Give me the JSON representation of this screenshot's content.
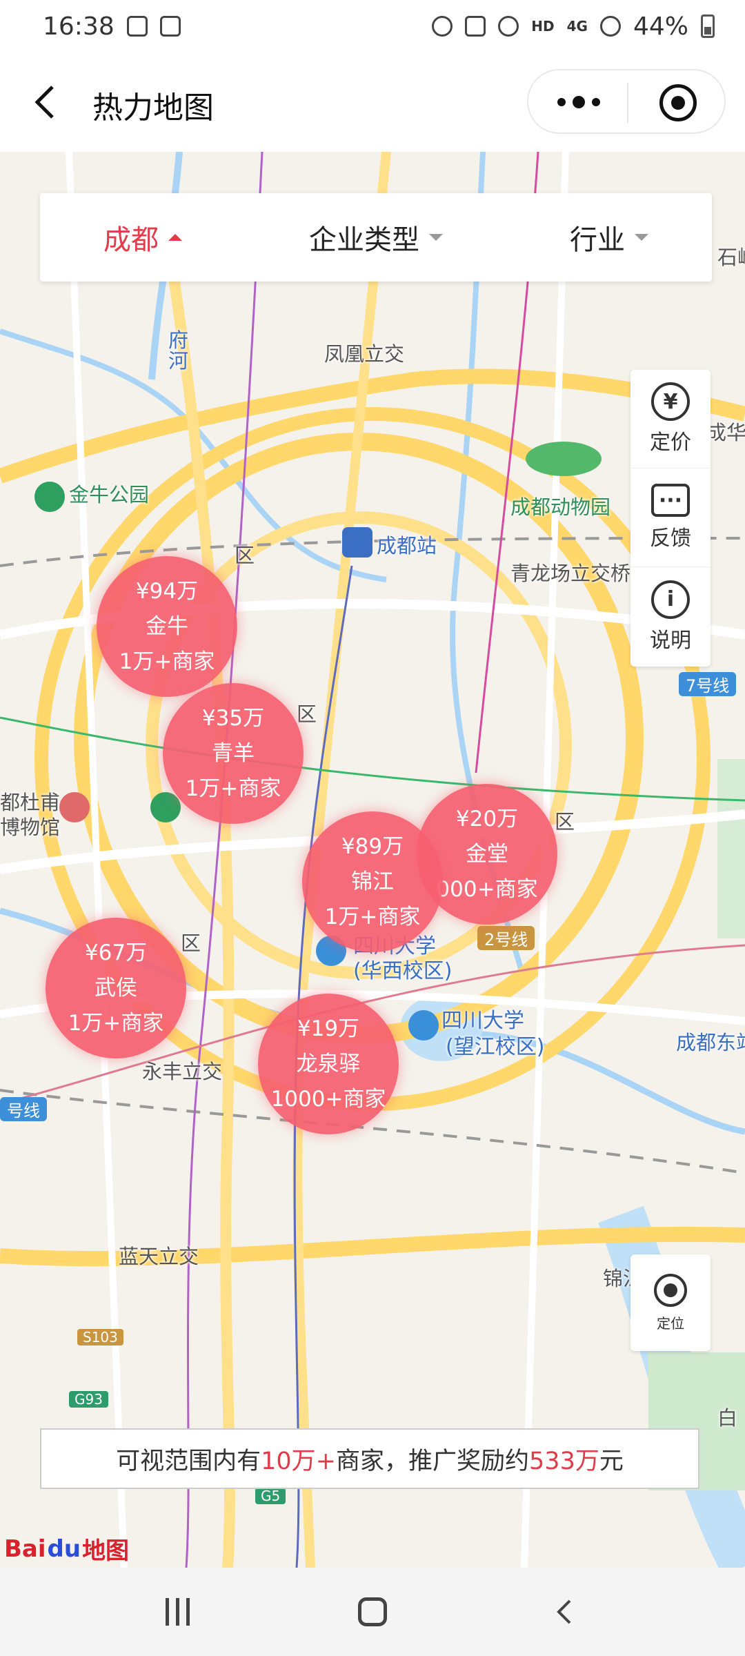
{
  "status_bar": {
    "time": "16:38",
    "hd": "HD",
    "network": "4G",
    "battery": "44%"
  },
  "header": {
    "title": "热力地图"
  },
  "filters": [
    {
      "label": "成都",
      "active": true
    },
    {
      "label": "企业类型",
      "active": false
    },
    {
      "label": "行业",
      "active": false
    }
  ],
  "tools": [
    {
      "label": "定价",
      "icon": "yuan-circle-icon",
      "glyph": "¥"
    },
    {
      "label": "反馈",
      "icon": "chat-bubble-icon",
      "glyph": "···"
    },
    {
      "label": "说明",
      "icon": "info-circle-icon",
      "glyph": "i"
    }
  ],
  "locate_label": "定位",
  "bubbles": [
    {
      "price": "¥94万",
      "area": "金牛",
      "count": "1万+商家"
    },
    {
      "price": "¥35万",
      "area": "青羊",
      "count": "1万+商家"
    },
    {
      "price": "¥20万",
      "area": "金堂",
      "count": "000+商家"
    },
    {
      "price": "¥89万",
      "area": "锦江",
      "count": "1万+商家"
    },
    {
      "price": "¥67万",
      "area": "武侯",
      "count": "1万+商家"
    },
    {
      "price": "¥19万",
      "area": "龙泉驿",
      "count": "1000+商家"
    }
  ],
  "map_labels": {
    "fenghuang": "凤凰立交",
    "jinniu_park": "金牛公园",
    "zoo": "成都动物园",
    "station": "成都站",
    "qinglongchang": "青龙场立交桥",
    "chengdu_east": "成都东站",
    "chenghua": "成华",
    "shiling": "石岭",
    "line7": "7号线",
    "line2": "2号线",
    "line_left": "号线",
    "du_museum": "都杜甫",
    "museum": "博物馆",
    "scu_huaxi1": "四川大学",
    "scu_huaxi2": "(华西校区)",
    "scu_wangjiang1": "四川大学",
    "scu_wangjiang2": "(望江校区)",
    "yongfeng": "永丰立交",
    "lantian": "蓝天立交",
    "jin": "锦江",
    "s103": "S103",
    "g93": "G93",
    "g5": "G5",
    "zi": "白",
    "qu1": "区",
    "qu2": "区",
    "qu3": "区",
    "qu4": "区",
    "river": "府河"
  },
  "info_bar": {
    "prefix": "可视范围内有",
    "merchants": "10万+",
    "middle": "商家，推广奖励约",
    "reward": "533万",
    "suffix": "元"
  },
  "baidu": {
    "bai": "Bai",
    "du": "du",
    "ditu": "地图"
  }
}
